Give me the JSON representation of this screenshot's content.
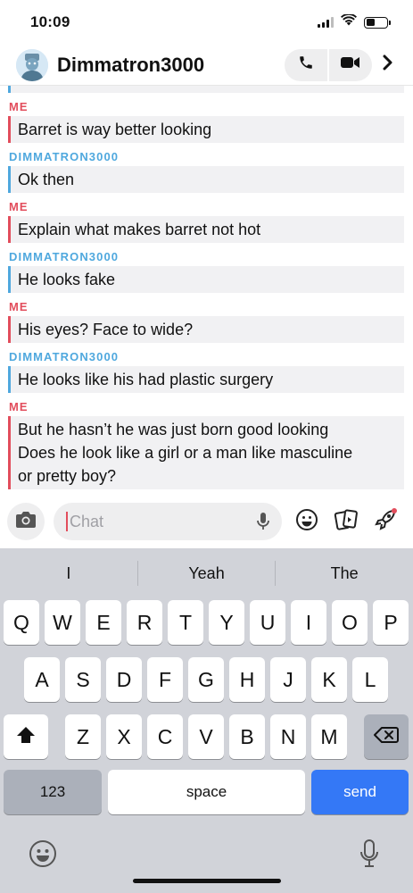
{
  "status_bar": {
    "time": "10:09"
  },
  "header": {
    "contact_name": "Dimmatron3000"
  },
  "messages": [
    {
      "sender": "ME",
      "from": "me",
      "text": "Barret is way better looking"
    },
    {
      "sender": "DIMMATRON3000",
      "from": "them",
      "text": "Ok then"
    },
    {
      "sender": "ME",
      "from": "me",
      "text": "Explain what makes barret not hot"
    },
    {
      "sender": "DIMMATRON3000",
      "from": "them",
      "text": "He looks fake"
    },
    {
      "sender": "ME",
      "from": "me",
      "text": "His eyes? Face to wide?"
    },
    {
      "sender": "DIMMATRON3000",
      "from": "them",
      "text": "He looks like his had plastic surgery"
    },
    {
      "sender": "ME",
      "from": "me",
      "lines": [
        "But he hasn’t he was just born good looking",
        "Does he look like a girl or a man like masculine",
        "or pretty boy?"
      ]
    }
  ],
  "composer": {
    "placeholder": "Chat"
  },
  "keyboard": {
    "suggestions": [
      "I",
      "Yeah",
      "The"
    ],
    "row1": [
      "Q",
      "W",
      "E",
      "R",
      "T",
      "Y",
      "U",
      "I",
      "O",
      "P"
    ],
    "row2": [
      "A",
      "S",
      "D",
      "F",
      "G",
      "H",
      "J",
      "K",
      "L"
    ],
    "row3": [
      "Z",
      "X",
      "C",
      "V",
      "B",
      "N",
      "M"
    ],
    "numbers_label": "123",
    "space_label": "space",
    "send_label": "send"
  },
  "colors": {
    "me": "#e24d5c",
    "them": "#4fa8de",
    "send": "#3478f6"
  }
}
